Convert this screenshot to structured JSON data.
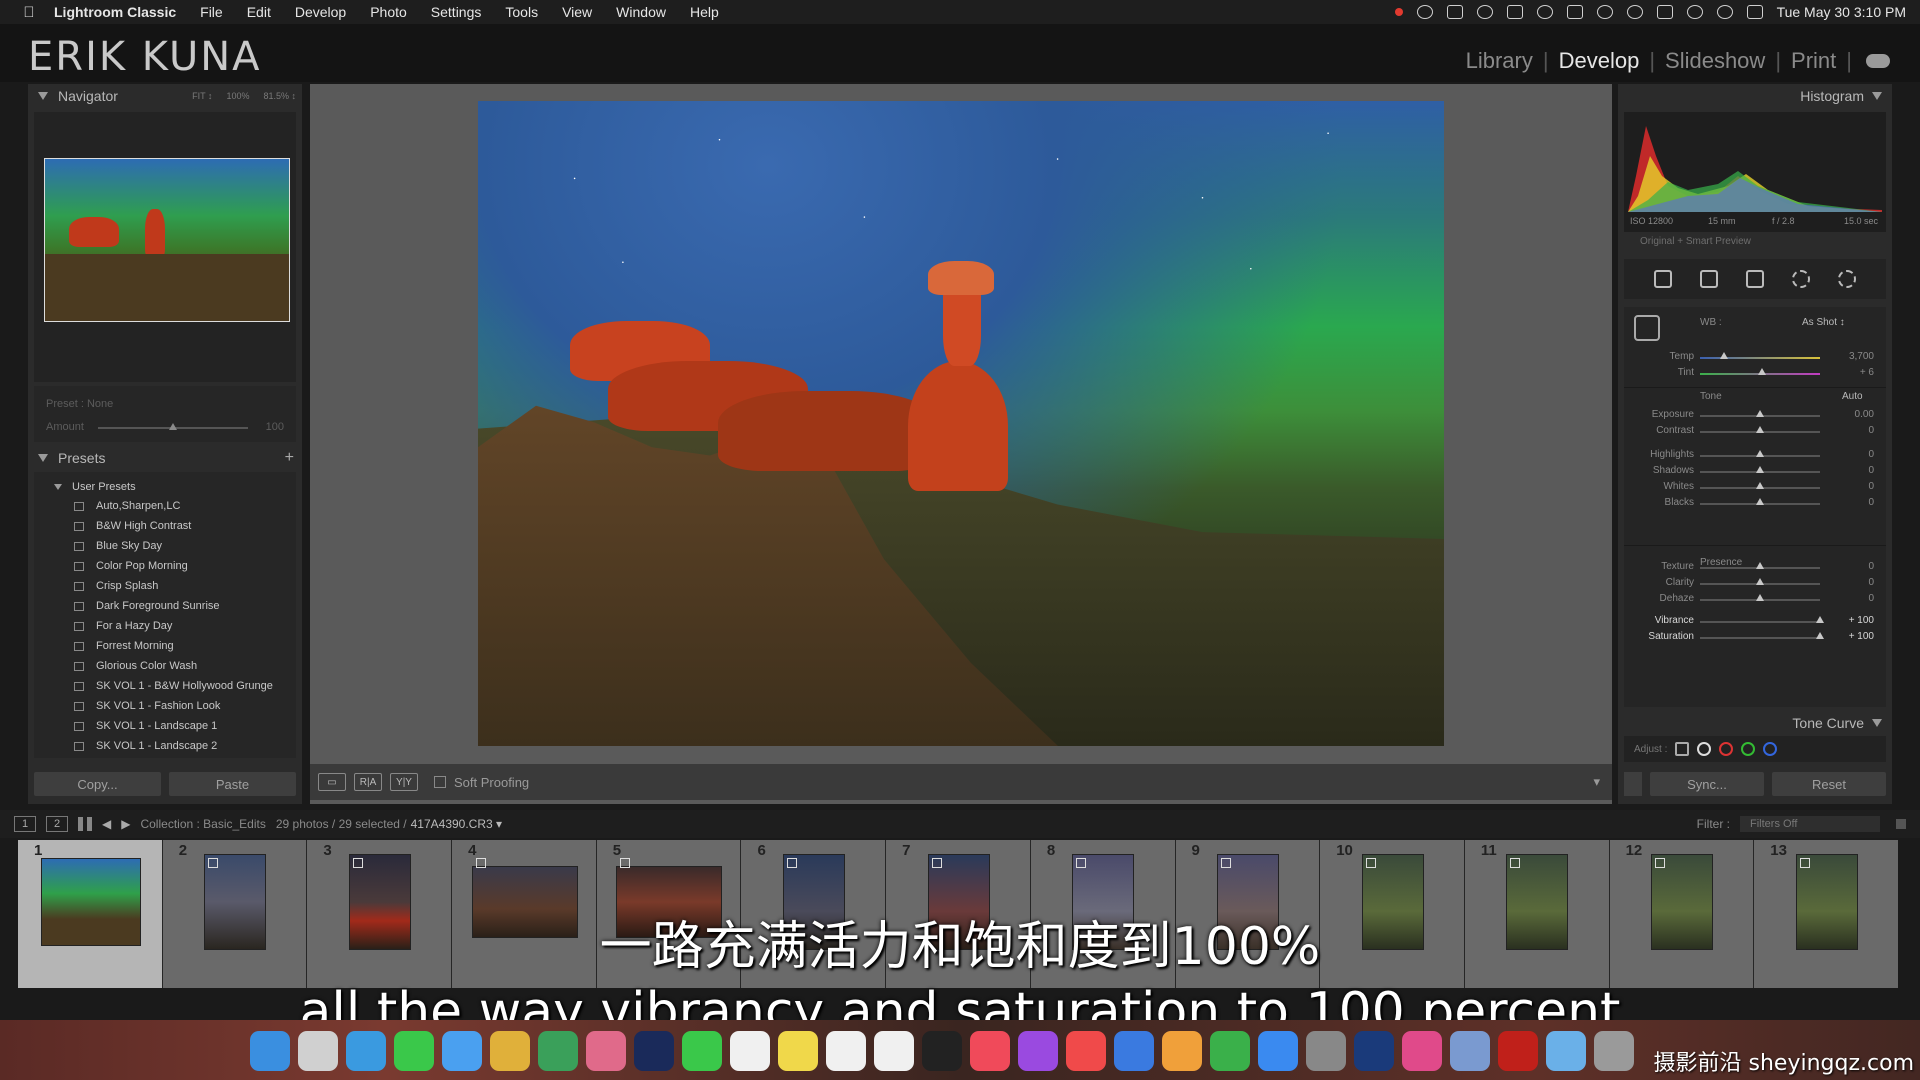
{
  "menubar": {
    "app_name": "Lightroom Classic",
    "menus": [
      "File",
      "Edit",
      "Develop",
      "Photo",
      "Settings",
      "Tools",
      "View",
      "Window",
      "Help"
    ],
    "clock": "Tue May 30  3:10 PM"
  },
  "identity": {
    "brand": "ERIK KUNA",
    "modules": [
      "Library",
      "Develop",
      "Slideshow",
      "Print"
    ],
    "active_module": "Develop"
  },
  "left_panel": {
    "navigator_title": "Navigator",
    "nav_options": [
      "FIT ↕",
      "100%",
      "81.5% ↕"
    ],
    "preset_label": "Preset : None",
    "amount_label": "Amount",
    "amount_value": "100",
    "presets_title": "Presets",
    "group_name": "User Presets",
    "presets": [
      "Auto,Sharpen,LC",
      "B&W High Contrast",
      "Blue Sky Day",
      "Color Pop Morning",
      "Crisp Splash",
      "Dark Foreground Sunrise",
      "For a Hazy Day",
      "Forrest Morning",
      "Glorious Color Wash",
      "SK VOL 1 - B&W Hollywood Grunge",
      "SK VOL 1 - Fashion Look",
      "SK VOL 1 - Landscape 1",
      "SK VOL 1 - Landscape 2"
    ],
    "copy_label": "Copy...",
    "paste_label": "Paste"
  },
  "center": {
    "soft_proofing_label": "Soft Proofing"
  },
  "right_panel": {
    "histogram_title": "Histogram",
    "exif": {
      "iso": "ISO 12800",
      "focal": "15 mm",
      "aperture": "f / 2.8",
      "shutter": "15.0 sec"
    },
    "preview_note": "Original + Smart Preview",
    "wb_label": "WB :",
    "wb_value": "As Shot ↕",
    "tone_label": "Tone",
    "auto_label": "Auto",
    "presence_label": "Presence",
    "sliders": [
      {
        "label": "Temp",
        "value": "3,700",
        "pos": 0.2
      },
      {
        "label": "Tint",
        "value": "+ 6",
        "pos": 0.52
      },
      {
        "label": "Exposure",
        "value": "0.00",
        "pos": 0.5
      },
      {
        "label": "Contrast",
        "value": "0",
        "pos": 0.5
      },
      {
        "label": "Highlights",
        "value": "0",
        "pos": 0.5
      },
      {
        "label": "Shadows",
        "value": "0",
        "pos": 0.5
      },
      {
        "label": "Whites",
        "value": "0",
        "pos": 0.5
      },
      {
        "label": "Blacks",
        "value": "0",
        "pos": 0.5
      },
      {
        "label": "Texture",
        "value": "0",
        "pos": 0.5
      },
      {
        "label": "Clarity",
        "value": "0",
        "pos": 0.5
      },
      {
        "label": "Dehaze",
        "value": "0",
        "pos": 0.5
      },
      {
        "label": "Vibrance",
        "value": "+ 100",
        "pos": 1.0
      },
      {
        "label": "Saturation",
        "value": "+ 100",
        "pos": 1.0
      }
    ],
    "tone_curve_title": "Tone Curve",
    "adjust_label": "Adjust :",
    "sync_label": "Sync...",
    "reset_label": "Reset"
  },
  "filmstrip_header": {
    "pages": [
      "1",
      "2"
    ],
    "collection": "Collection : Basic_Edits",
    "count": "29 photos / 29 selected /",
    "filename": "417A4390.CR3 ▾",
    "filter_label": "Filter :",
    "filter_value": "Filters Off"
  },
  "filmstrip": [
    "1",
    "2",
    "3",
    "4",
    "5",
    "6",
    "7",
    "8",
    "9",
    "10",
    "11",
    "12",
    "13"
  ],
  "subtitles": {
    "zh": "一路充满活力和饱和度到100%",
    "en": "all the way vibrancy and saturation to 100 percent"
  },
  "watermark": "摄影前沿 sheyingqz.com",
  "colors": {
    "panel": "#2b2b2b",
    "accent_active": "#e6e6e6",
    "sky_green": "#2aa84f",
    "rock_red": "#c0391b"
  },
  "dock_icons": [
    "finder-icon",
    "launchpad-icon",
    "safari-icon",
    "messages-icon",
    "mail-icon",
    "chrome-icon",
    "maps-icon",
    "photos-icon",
    "lightroom-icon",
    "facetime-icon",
    "calendar-icon",
    "notes-icon",
    "reminders-icon",
    "freeform-icon",
    "tv-icon",
    "music-icon",
    "podcasts-icon",
    "news-icon",
    "keynote-icon",
    "pages-icon",
    "numbers-icon",
    "appstore-icon",
    "settings-icon",
    "photoshop-icon",
    "slack-icon",
    "preview-icon",
    "acrobat-icon",
    "folder-icon",
    "trash-icon"
  ]
}
